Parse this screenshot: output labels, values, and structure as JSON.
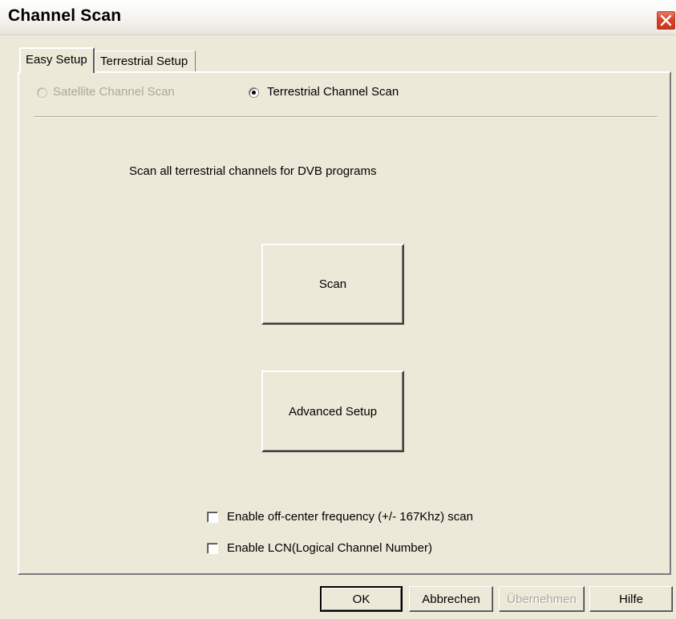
{
  "window": {
    "title": "Channel Scan"
  },
  "tabs": [
    {
      "label": "Easy Setup",
      "active": true
    },
    {
      "label": "Terrestrial Setup",
      "active": false
    }
  ],
  "scan_type": {
    "satellite_label": "Satellite Channel Scan",
    "satellite_enabled": false,
    "terrestrial_label": "Terrestrial Channel Scan",
    "selected": "terrestrial"
  },
  "description": "Scan all terrestrial channels for DVB programs",
  "buttons": {
    "scan": "Scan",
    "advanced_setup": "Advanced Setup"
  },
  "options": [
    {
      "label": "Enable off-center frequency (+/- 167Khz) scan",
      "checked": false
    },
    {
      "label": "Enable LCN(Logical Channel Number)",
      "checked": false
    }
  ],
  "footer": {
    "ok": "OK",
    "cancel": "Abbrechen",
    "apply": "Übernehmen",
    "apply_enabled": false,
    "help": "Hilfe"
  },
  "colors": {
    "dialog_bg": "#ece9d8",
    "disabled_text": "#aca899",
    "close_button": "#d9432a"
  }
}
